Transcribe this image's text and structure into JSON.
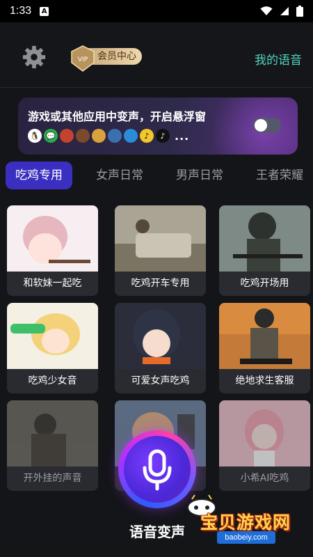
{
  "status_bar": {
    "time": "1:33",
    "a_badge": "A"
  },
  "header": {
    "vip_label": "会员中心",
    "vip_badge": "VIP",
    "my_voice": "我的语音"
  },
  "banner": {
    "title": "游戏或其他应用中变声，开启悬浮窗",
    "ellipsis": "...",
    "toggle_on": false,
    "apps": [
      "QQ",
      "微信",
      "游戏",
      "游戏",
      "游戏",
      "游戏",
      "游戏",
      "QQ音乐",
      "抖音"
    ]
  },
  "tabs": [
    {
      "label": "吃鸡专用",
      "active": true
    },
    {
      "label": "女声日常",
      "active": false
    },
    {
      "label": "男声日常",
      "active": false
    },
    {
      "label": "王者荣耀",
      "active": false
    }
  ],
  "cards": [
    {
      "label": "和软妹一起吃"
    },
    {
      "label": "吃鸡开车专用"
    },
    {
      "label": "吃鸡开场用"
    },
    {
      "label": "吃鸡少女音"
    },
    {
      "label": "可爱女声吃鸡"
    },
    {
      "label": "绝地求生客服"
    },
    {
      "label": "开外挂的声音"
    },
    {
      "label": ""
    },
    {
      "label": "小希AI吃鸡"
    }
  ],
  "mic": {
    "label": "语音变声"
  },
  "watermark": {
    "text": "宝贝游戏网",
    "url": "baobeiy.com"
  },
  "colors": {
    "accent": "#3a2fc0",
    "teal": "#4fd3bf",
    "background": "#141519"
  }
}
